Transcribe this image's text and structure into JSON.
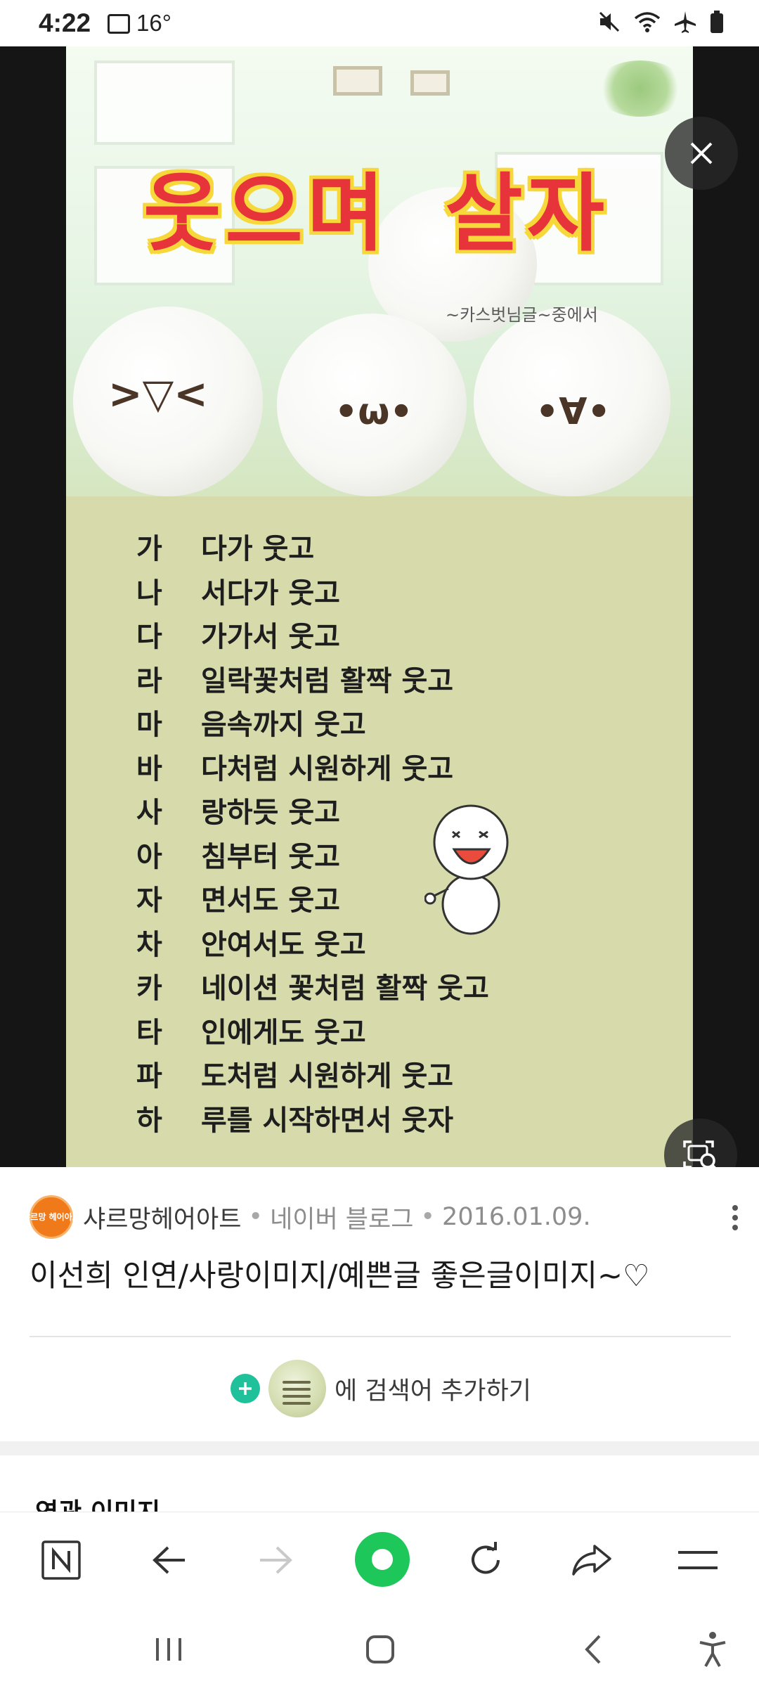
{
  "status_bar": {
    "time": "4:22",
    "temperature": "16°",
    "icons": [
      "gallery-icon",
      "mute-icon",
      "wifi-icon",
      "airplane-icon",
      "battery-icon"
    ]
  },
  "viewer": {
    "poster": {
      "title_word1": "웃으며",
      "title_word2": "살자",
      "credit": "~카스벗님글~중에서",
      "faces": [
        ">▽<",
        "•ω•",
        "•∀•"
      ],
      "lines": [
        {
          "key": "가",
          "text": "다가 웃고"
        },
        {
          "key": "나",
          "text": "서다가 웃고"
        },
        {
          "key": "다",
          "text": "가가서 웃고"
        },
        {
          "key": "라",
          "text": "일락꽃처럼 활짝 웃고"
        },
        {
          "key": "마",
          "text": "음속까지 웃고"
        },
        {
          "key": "바",
          "text": "다처럼 시원하게 웃고"
        },
        {
          "key": "사",
          "text": "랑하듯 웃고"
        },
        {
          "key": "아",
          "text": "침부터 웃고"
        },
        {
          "key": "자",
          "text": "면서도 웃고"
        },
        {
          "key": "차",
          "text": "안여서도 웃고"
        },
        {
          "key": "카",
          "text": "네이션 꽃처럼 활짝 웃고"
        },
        {
          "key": "타",
          "text": "인에게도 웃고"
        },
        {
          "key": "파",
          "text": "도처럼 시원하게 웃고"
        },
        {
          "key": "하",
          "text": "루를 시작하면서 웃자"
        }
      ]
    },
    "close_icon": "close-icon",
    "lens_icon": "image-search-icon"
  },
  "info": {
    "logo_text": "샤르망 헤어아트",
    "source_name": "샤르망헤어아트",
    "separator": "•",
    "platform": "네이버 블로그",
    "date": "2016.01.09.",
    "title": "이선희 인연/사랑이미지/예쁜글 좋은글이미지~♡",
    "add_search_text": "에 검색어 추가하기"
  },
  "related": {
    "title": "연관 이미지"
  },
  "toolbar": {
    "items": [
      "naver-icon",
      "back-icon",
      "forward-icon",
      "home-icon",
      "refresh-icon",
      "share-icon",
      "menu-icon"
    ]
  },
  "system_nav": {
    "items": [
      "recents-icon",
      "home-icon",
      "back-icon",
      "accessibility-icon"
    ]
  },
  "colors": {
    "accent_green": "#1ec75a",
    "add_green": "#1ec19a",
    "title_red": "#e7343b",
    "title_yellow": "#f7d83b"
  }
}
